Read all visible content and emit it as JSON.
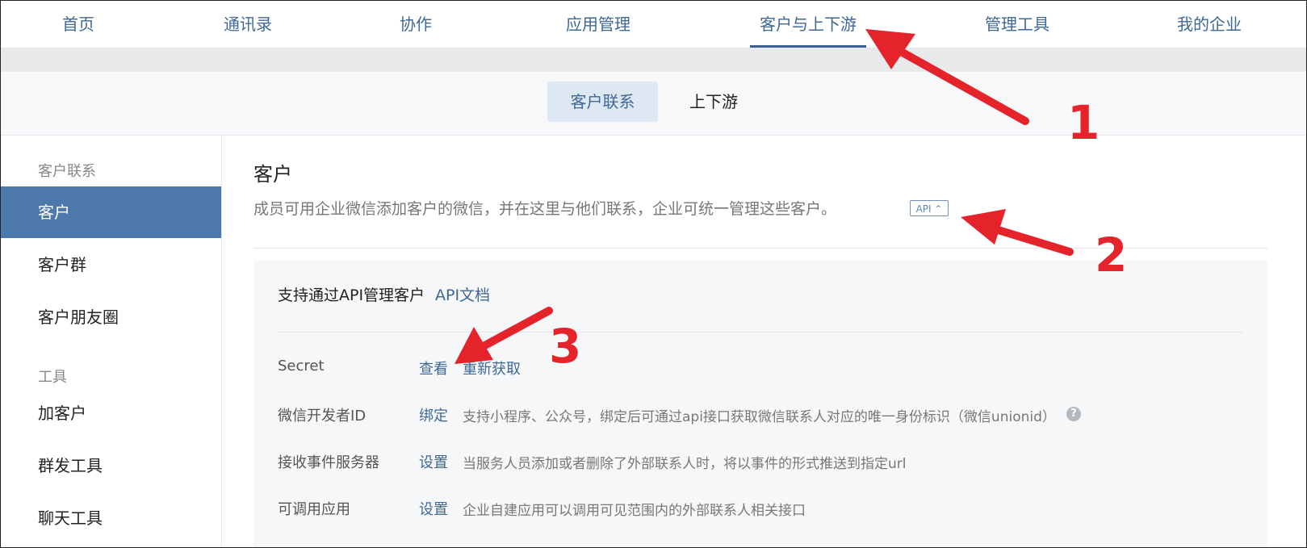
{
  "topnav": {
    "items": [
      "首页",
      "通讯录",
      "协作",
      "应用管理",
      "客户与上下游",
      "管理工具",
      "我的企业"
    ],
    "active_index": 4
  },
  "subtabs": {
    "items": [
      "客户联系",
      "上下游"
    ],
    "active_index": 0
  },
  "sidebar": {
    "groups": [
      {
        "label": "客户联系",
        "items": [
          "客户",
          "客户群",
          "客户朋友圈"
        ]
      },
      {
        "label": "工具",
        "items": [
          "加客户",
          "群发工具",
          "聊天工具"
        ]
      }
    ],
    "active_item": "客户"
  },
  "main": {
    "title": "客户",
    "description": "成员可用企业微信添加客户的微信，并在这里与他们联系，企业可统一管理这些客户。",
    "api_badge": "API ⌃",
    "panel": {
      "title": "支持通过API管理客户",
      "doc_link": "API文档",
      "rows": [
        {
          "label": "Secret",
          "actions": [
            "查看",
            "重新获取"
          ],
          "desc": ""
        },
        {
          "label": "微信开发者ID",
          "actions": [
            "绑定"
          ],
          "desc": "支持小程序、公众号，绑定后可通过api接口获取微信联系人对应的唯一身份标识（微信unionid）"
        },
        {
          "label": "接收事件服务器",
          "actions": [
            "设置"
          ],
          "desc": "当服务人员添加或者删除了外部联系人时，将以事件的形式推送到指定url"
        },
        {
          "label": "可调用应用",
          "actions": [
            "设置"
          ],
          "desc": "企业自建应用可以调用可见范围内的外部联系人相关接口"
        }
      ]
    }
  },
  "annotations": {
    "numbers": [
      "1",
      "2",
      "3"
    ],
    "color": "#e5232a"
  },
  "colors": {
    "accent": "#3f6896",
    "sidebar_active_bg": "#4c78ab",
    "subtab_active_bg": "#dde8f3"
  },
  "icons": {
    "help": "question-circle-icon",
    "api_chevron": "chevron-up-icon"
  }
}
